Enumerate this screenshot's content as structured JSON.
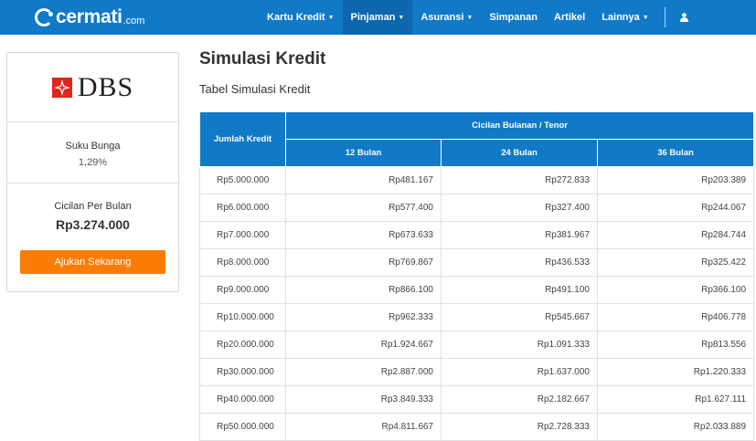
{
  "header": {
    "logo_word": "cermati",
    "logo_tld": ".com",
    "nav": [
      {
        "label": "Kartu Kredit",
        "dropdown": true
      },
      {
        "label": "Pinjaman",
        "dropdown": true,
        "active": true
      },
      {
        "label": "Asuransi",
        "dropdown": true
      },
      {
        "label": "Simpanan",
        "dropdown": false
      },
      {
        "label": "Artikel",
        "dropdown": false
      },
      {
        "label": "Lainnya",
        "dropdown": true
      }
    ]
  },
  "sidebar": {
    "bank_name": "DBS",
    "rate_label": "Suku Bunga",
    "rate_value": "1,29%",
    "installment_label": "Cicilan Per Bulan",
    "installment_value": "Rp3.274.000",
    "apply_label": "Ajukan Sekarang"
  },
  "main": {
    "title": "Simulasi Kredit",
    "subtitle": "Tabel Simulasi Kredit",
    "table": {
      "col_amount": "Jumlah Kredit",
      "col_group": "Cicilan Bulanan / Tenor",
      "tenors": [
        "12 Bulan",
        "24 Bulan",
        "36 Bulan"
      ],
      "rows": [
        [
          "Rp5.000.000",
          "Rp481.167",
          "Rp272.833",
          "Rp203.389"
        ],
        [
          "Rp6.000.000",
          "Rp577.400",
          "Rp327.400",
          "Rp244.067"
        ],
        [
          "Rp7.000.000",
          "Rp673.633",
          "Rp381.967",
          "Rp284.744"
        ],
        [
          "Rp8.000.000",
          "Rp769.867",
          "Rp436.533",
          "Rp325.422"
        ],
        [
          "Rp9.000.000",
          "Rp866.100",
          "Rp491.100",
          "Rp366.100"
        ],
        [
          "Rp10.000.000",
          "Rp962.333",
          "Rp545.667",
          "Rp406.778"
        ],
        [
          "Rp20.000.000",
          "Rp1.924.667",
          "Rp1.091.333",
          "Rp813.556"
        ],
        [
          "Rp30.000.000",
          "Rp2.887.000",
          "Rp1.637.000",
          "Rp1.220.333"
        ],
        [
          "Rp40.000.000",
          "Rp3.849.333",
          "Rp2.182.667",
          "Rp1.627.111"
        ],
        [
          "Rp50.000.000",
          "Rp4.811.667",
          "Rp2.728.333",
          "Rp2.033.889"
        ]
      ]
    }
  },
  "colors": {
    "primary": "#1079c8",
    "nav_active": "#0c67ad",
    "cta": "#fb7c05",
    "dbs_red": "#e1251b"
  }
}
